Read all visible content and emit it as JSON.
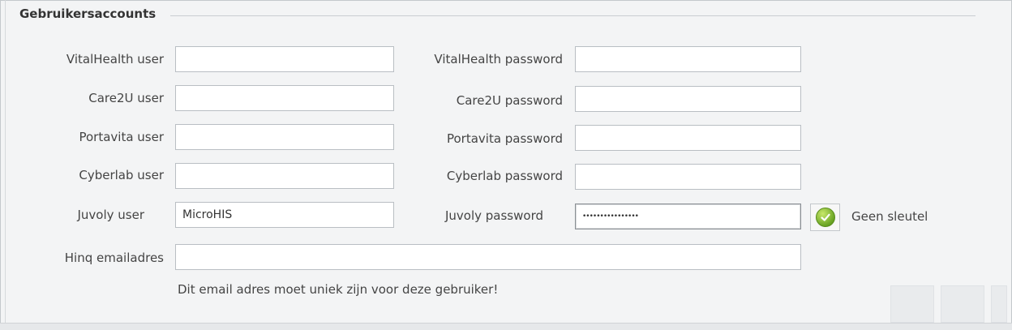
{
  "section": {
    "title": "Gebruikersaccounts"
  },
  "rows": [
    {
      "user_label": "VitalHealth user",
      "user_value": "",
      "password_label": "VitalHealth password",
      "password_value": ""
    },
    {
      "user_label": "Care2U user",
      "user_value": "",
      "password_label": "Care2U password",
      "password_value": ""
    },
    {
      "user_label": "Portavita user",
      "user_value": "",
      "password_label": "Portavita password",
      "password_value": ""
    },
    {
      "user_label": "Cyberlab user",
      "user_value": "",
      "password_label": "Cyberlab password",
      "password_value": ""
    },
    {
      "user_label": "Juvoly user",
      "user_value": "MicroHIS",
      "password_label": "Juvoly password",
      "password_value": "••••••••••••••••"
    }
  ],
  "key_status": {
    "label": "Geen sleutel",
    "icon": "check-circle-icon",
    "icon_color": "#6aa424"
  },
  "email": {
    "label": "Hinq emailadres",
    "value": "",
    "hint": "Dit email adres moet uniek zijn voor deze gebruiker!"
  },
  "colors": {
    "background": "#f3f4f5",
    "field_border": "#b9bec3",
    "accent_green": "#6aa424"
  }
}
